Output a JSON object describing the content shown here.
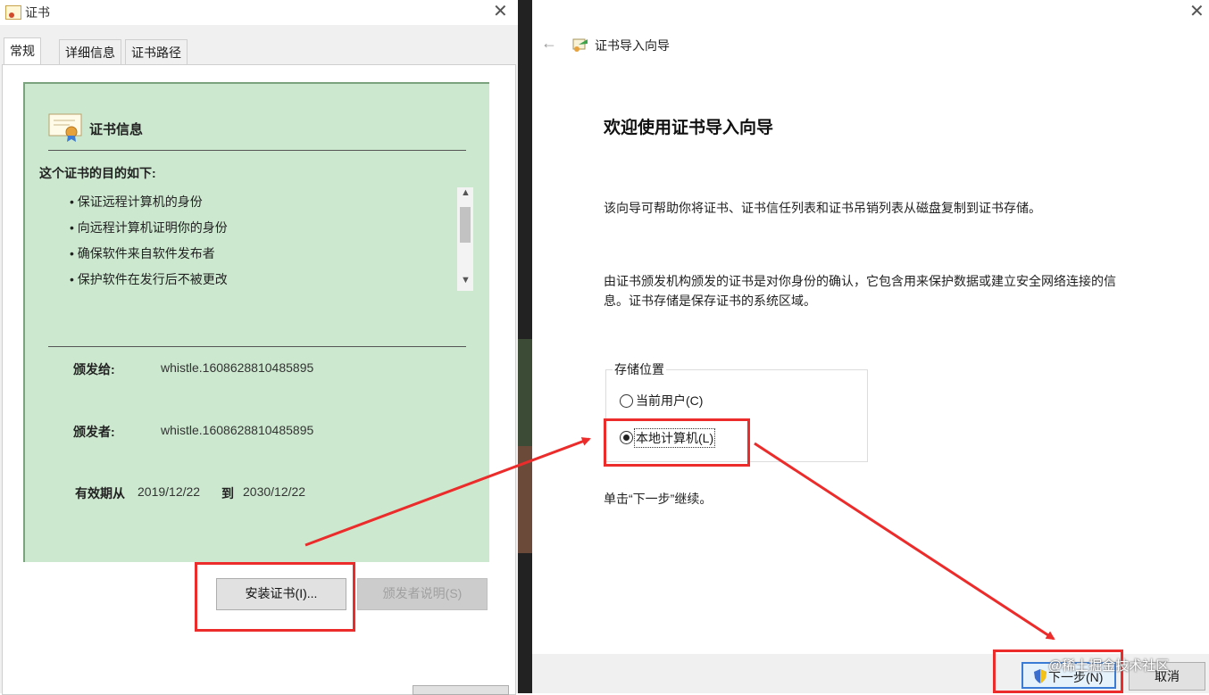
{
  "left_dialog": {
    "title": "证书",
    "tabs": [
      "常规",
      "详细信息",
      "证书路径"
    ],
    "cert_info_heading": "证书信息",
    "purpose_heading": "这个证书的目的如下:",
    "purposes": [
      "• 保证远程计算机的身份",
      "• 向远程计算机证明你的身份",
      "• 确保软件来自软件发布者",
      "• 保护软件在发行后不被更改"
    ],
    "issued_to_label": "颁发给:",
    "issued_to_value": "whistle.1608628810485895",
    "issued_by_label": "颁发者:",
    "issued_by_value": "whistle.1608628810485895",
    "valid_from_label": "有效期从",
    "valid_from": "2019/12/22",
    "valid_to_label": "到",
    "valid_to": "2030/12/22",
    "install_button": "安装证书(I)...",
    "issuer_statement_button": "颁发者说明(S)"
  },
  "right_dialog": {
    "title": "证书导入向导",
    "heading": "欢迎使用证书导入向导",
    "para1": "该向导可帮助你将证书、证书信任列表和证书吊销列表从磁盘复制到证书存储。",
    "para2_line1": "由证书颁发机构颁发的证书是对你身份的确认，它包含用来保护数据或建立安全网络连接的信",
    "para2_line2": "息。证书存储是保存证书的系统区域。",
    "store_location_label": "存储位置",
    "option_current_user": "当前用户(C)",
    "option_local_machine": "本地计算机(L)",
    "selected_option": "本地计算机(L)",
    "continue_hint": "单击“下一步”继续。",
    "next_button": "下一步(N)",
    "cancel_button": "取消"
  },
  "watermark": "@稀土掘金技术社区",
  "colors": {
    "highlight_red": "#ec2b2b",
    "panel_green": "#cce8cf"
  }
}
